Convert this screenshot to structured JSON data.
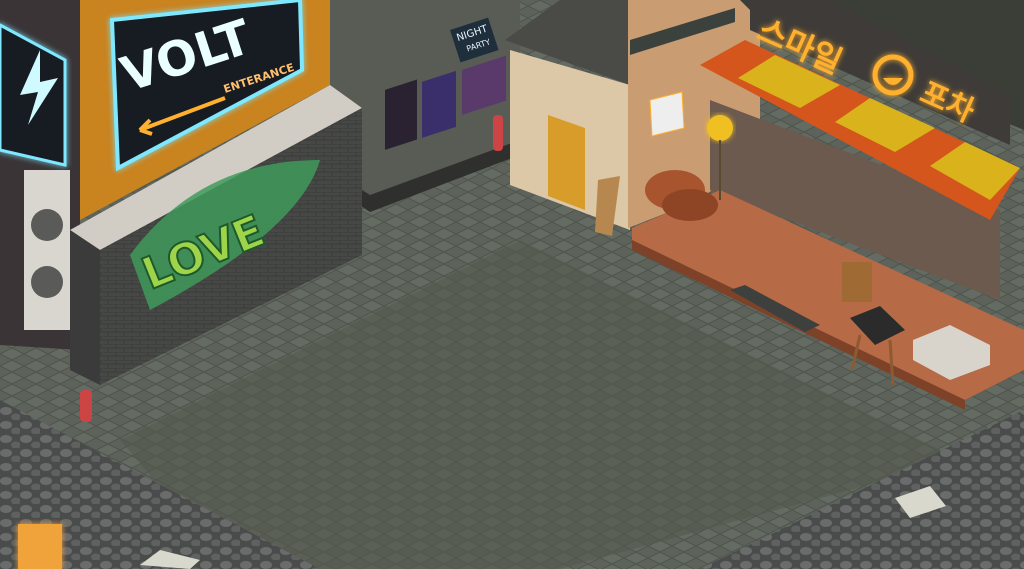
{
  "scene": {
    "volt_sign": {
      "title": "VOLT",
      "subtitle": "ENTERANCE"
    },
    "graffiti": "LOVE",
    "poster": {
      "line1": "NIGHT",
      "line2": "PARTY"
    },
    "restaurant_sign": {
      "left": "스마일",
      "right": "포차"
    },
    "colors": {
      "pavement": "#5b615a",
      "neon_cyan": "#7fe8ff",
      "neon_orange": "#ffb02e",
      "awning_orange": "#d4561c",
      "awning_yellow": "#d9b21c",
      "deck_wood": "#b66a45"
    }
  }
}
